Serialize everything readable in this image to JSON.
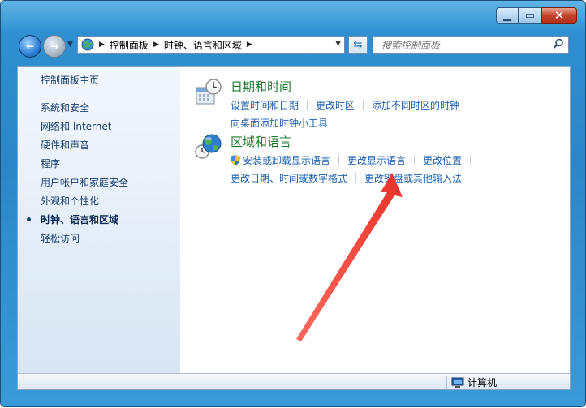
{
  "address": {
    "crumbs": [
      "控制面板",
      "时钟、语言和区域"
    ]
  },
  "search": {
    "placeholder": "搜索控制面板"
  },
  "sidebar": {
    "home": "控制面板主页",
    "items": [
      {
        "label": "系统和安全"
      },
      {
        "label": "网络和 Internet"
      },
      {
        "label": "硬件和声音"
      },
      {
        "label": "程序"
      },
      {
        "label": "用户帐户和家庭安全"
      },
      {
        "label": "外观和个性化"
      },
      {
        "label": "时钟、语言和区域",
        "active": true
      },
      {
        "label": "轻松访问"
      }
    ]
  },
  "categories": [
    {
      "title": "日期和时间",
      "icon": "clock-calendar-icon",
      "row1": [
        "设置时间和日期",
        "更改时区",
        "添加不同时区的时钟"
      ],
      "row2": [
        "向桌面添加时钟小工具"
      ]
    },
    {
      "title": "区域和语言",
      "icon": "globe-clock-icon",
      "row1": [
        "安装或卸载显示语言",
        "更改显示语言",
        "更改位置"
      ],
      "row2": [
        "更改日期、时间或数字格式",
        "更改键盘或其他输入法"
      ]
    }
  ],
  "statusbar": {
    "computer": "计算机"
  },
  "colors": {
    "link": "#1a5fae",
    "category_title": "#1e7a2e",
    "arrow": "#f0453a"
  }
}
